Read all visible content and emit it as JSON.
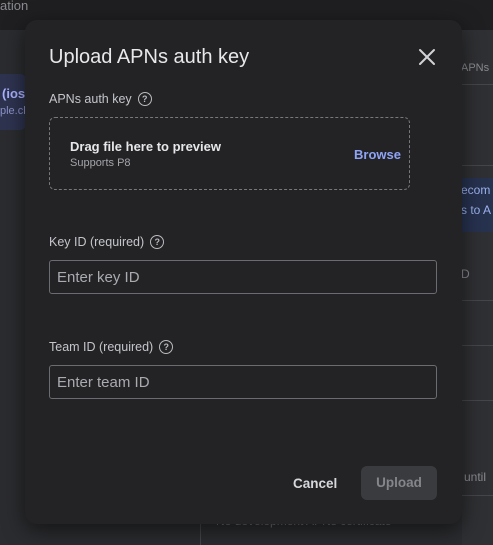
{
  "background": {
    "top_text": "ation",
    "left_title": "(ios",
    "left_sub": "ple.ch",
    "right_header": "APNs",
    "right_banner_line1": "ecom",
    "right_banner_line2": "s to A",
    "right_item": "D",
    "right_until": "until",
    "bottom_text": "No development APNs certificate"
  },
  "dialog": {
    "title": "Upload APNs auth key",
    "close_icon": "close-icon",
    "auth_key_label": "APNs auth key",
    "help_glyph": "?",
    "dropzone": {
      "title": "Drag file here to preview",
      "subtitle": "Supports P8",
      "browse": "Browse"
    },
    "key_id": {
      "label": "Key ID (required)",
      "placeholder": "Enter key ID",
      "value": ""
    },
    "team_id": {
      "label": "Team ID (required)",
      "placeholder": "Enter team ID",
      "value": ""
    },
    "cancel": "Cancel",
    "upload": "Upload"
  },
  "colors": {
    "dialog_bg": "#232325",
    "accent_link": "#8fa4f7",
    "disabled_button_bg": "#3a3b3f"
  }
}
